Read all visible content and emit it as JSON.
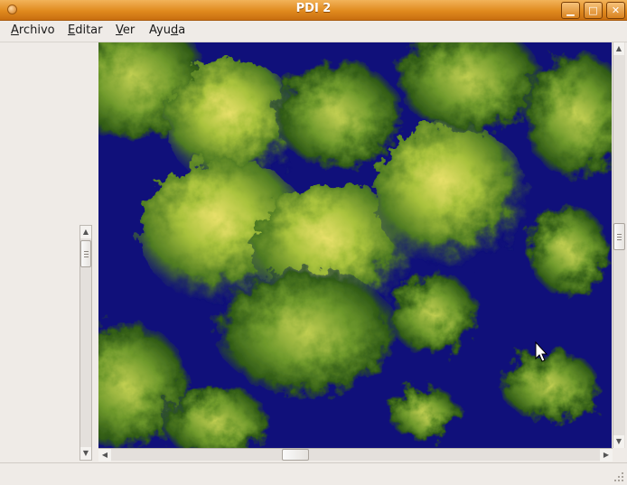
{
  "window": {
    "title": "PDI 2"
  },
  "window_buttons": {
    "minimize": "▁",
    "maximize": "□",
    "close": "✕"
  },
  "menu": [
    {
      "accel": "A",
      "rest": "rchivo"
    },
    {
      "accel": "E",
      "rest": "ditar"
    },
    {
      "accel": "V",
      "rest": "er"
    },
    {
      "pre": "Ayu",
      "accel": "d",
      "rest": "a"
    }
  ],
  "image": {
    "description_kind": "terrain-heightmap"
  },
  "colors": {
    "titlebar": "#e08a1e",
    "image_background": "#10107a",
    "terrain_low": "#2f5a16",
    "terrain_high": "#e8e06a"
  }
}
